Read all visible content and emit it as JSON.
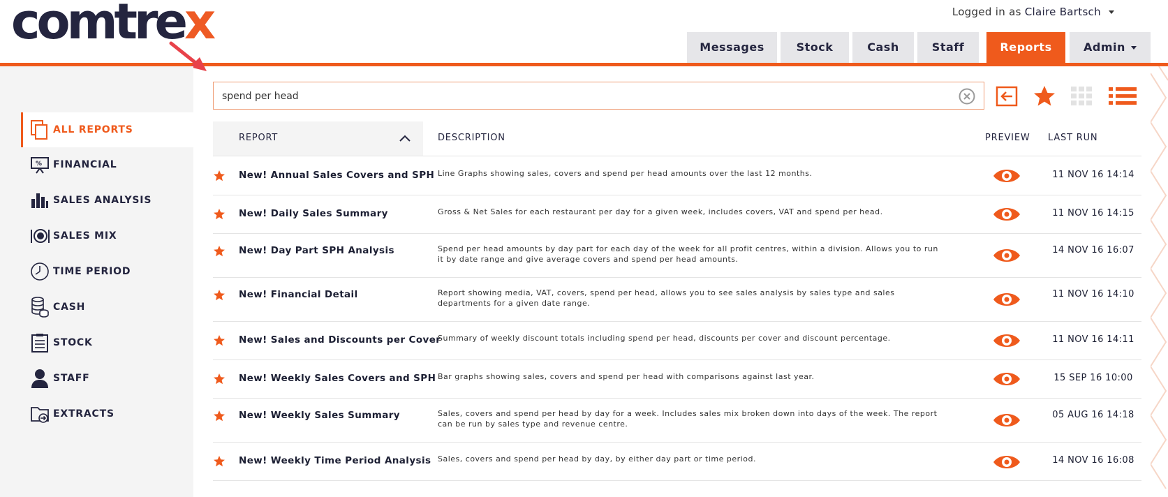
{
  "brand": {
    "logo_main": "comtre",
    "logo_x": "x",
    "accent_color": "#ef5a1c",
    "navy_color": "#24253f"
  },
  "user": {
    "prefix": "Logged in as",
    "name": "Claire Bartsch"
  },
  "nav": {
    "tabs": [
      {
        "label": "Messages",
        "active": false
      },
      {
        "label": "Stock",
        "active": false
      },
      {
        "label": "Cash",
        "active": false
      },
      {
        "label": "Staff",
        "active": false
      },
      {
        "label": "Reports",
        "active": true
      },
      {
        "label": "Admin",
        "active": false,
        "has_dropdown": true
      }
    ]
  },
  "sidebar": {
    "items": [
      {
        "label": "ALL REPORTS",
        "icon": "documents-icon",
        "active": true
      },
      {
        "label": "FINANCIAL",
        "icon": "presentation-percent-icon",
        "active": false
      },
      {
        "label": "SALES ANALYSIS",
        "icon": "bar-chart-icon",
        "active": false
      },
      {
        "label": "SALES MIX",
        "icon": "plate-cutlery-icon",
        "active": false
      },
      {
        "label": "TIME PERIOD",
        "icon": "clock-icon",
        "active": false
      },
      {
        "label": "CASH",
        "icon": "coins-icon",
        "active": false
      },
      {
        "label": "STOCK",
        "icon": "clipboard-icon",
        "active": false
      },
      {
        "label": "STAFF",
        "icon": "person-icon",
        "active": false
      },
      {
        "label": "EXTRACTS",
        "icon": "folder-export-icon",
        "active": false
      }
    ]
  },
  "search": {
    "value": "spend per head",
    "placeholder": ""
  },
  "toolbar": {
    "icons": [
      "back-arrow-icon",
      "favourite-star-icon",
      "grid-view-icon",
      "list-view-icon"
    ]
  },
  "table": {
    "columns": {
      "report": "REPORT",
      "description": "DESCRIPTION",
      "preview": "PREVIEW",
      "last_run": "LAST RUN"
    },
    "sort": "ascending",
    "rows": [
      {
        "name": "New! Annual Sales Covers and SPH",
        "description": "Line Graphs showing sales, covers and spend per head amounts over the last 12 months.",
        "last_run": "11 NOV 16 14:14",
        "favourite": true
      },
      {
        "name": "New! Daily Sales Summary",
        "description": "Gross & Net Sales for each restaurant per day for a given week, includes covers, VAT and spend per head.",
        "last_run": "11 NOV 16 14:15",
        "favourite": true
      },
      {
        "name": "New! Day Part SPH Analysis",
        "description": "Spend per head amounts by day part for each day of the week for all profit centres, within a division. Allows you to run it by date range and give average covers and spend per head amounts.",
        "last_run": "14 NOV 16 16:07",
        "favourite": true
      },
      {
        "name": "New! Financial Detail",
        "description": "Report showing media, VAT, covers, spend per head, allows you to see sales analysis by sales type and sales departments for a given date range.",
        "last_run": "11 NOV 16 14:10",
        "favourite": true
      },
      {
        "name": "New! Sales and Discounts per Cover",
        "description": "Summary of weekly discount totals including spend per head, discounts per cover and discount percentage.",
        "last_run": "11 NOV 16 14:11",
        "favourite": true
      },
      {
        "name": "New! Weekly Sales Covers and SPH",
        "description": "Bar graphs showing sales, covers and spend per head with comparisons against last year.",
        "last_run": "15 SEP 16 10:00",
        "favourite": true
      },
      {
        "name": "New! Weekly Sales Summary",
        "description": "Sales, covers and spend per head by day for a week. Includes sales mix broken down into days of the week. The report can be run by sales type and revenue centre.",
        "last_run": "05 AUG 16 14:18",
        "favourite": true
      },
      {
        "name": "New! Weekly Time Period Analysis",
        "description": "Sales, covers and spend per head by day, by either day part or time period.",
        "last_run": "14 NOV 16 16:08",
        "favourite": true
      }
    ]
  }
}
